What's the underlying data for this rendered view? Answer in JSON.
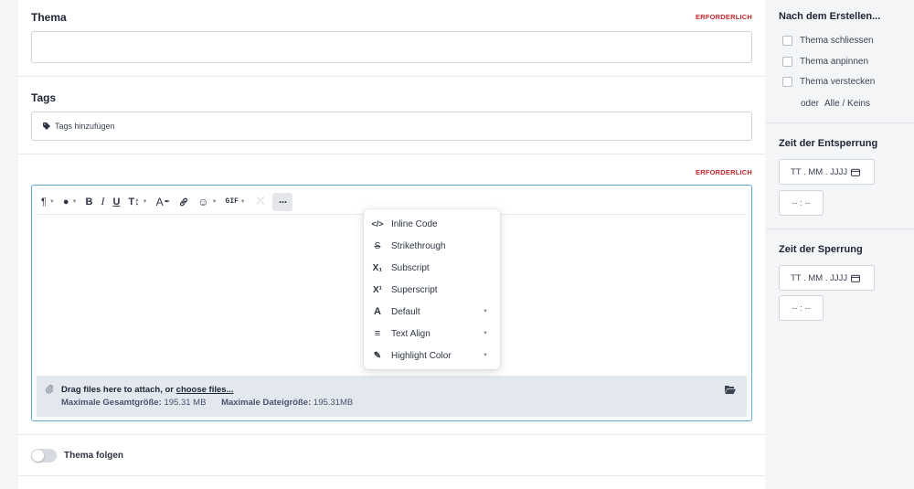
{
  "topic": {
    "label": "Thema",
    "required": "ERFORDERLICH",
    "value": ""
  },
  "tags": {
    "label": "Tags",
    "placeholder": "Tags hinzufügen"
  },
  "body": {
    "required": "ERFORDERLICH"
  },
  "toolbar": {
    "paragraph": "¶",
    "insert": "●",
    "bold": "B",
    "italic": "I",
    "underline": "U",
    "font_size": "T↕",
    "clear_format": "A",
    "link": "⊘",
    "emoji": "☺",
    "gif": "GIF",
    "strike_off": "⤬",
    "more": "···"
  },
  "more_menu": [
    {
      "icon": "</>",
      "label": "Inline Code",
      "has_caret": false
    },
    {
      "icon": "S",
      "label": "Strikethrough",
      "has_caret": false
    },
    {
      "icon": "X₁",
      "label": "Subscript",
      "has_caret": false
    },
    {
      "icon": "X¹",
      "label": "Superscript",
      "has_caret": false
    },
    {
      "icon": "A",
      "label": "Default",
      "has_caret": true
    },
    {
      "icon": "≡",
      "label": "Text Align",
      "has_caret": true
    },
    {
      "icon": "✎",
      "label": "Highlight Color",
      "has_caret": true
    }
  ],
  "upload": {
    "drag_text": "Drag files here to attach, or ",
    "choose_link": "choose files...",
    "total_label": "Maximale Gesamtgröße:",
    "total_value": "195.31 MB",
    "file_label": "Maximale Dateigröße:",
    "file_value": "195.31MB"
  },
  "follow": {
    "label": "Thema folgen",
    "on": false
  },
  "sidebar": {
    "after_title": "Nach dem Erstellen...",
    "options": [
      {
        "label": "Thema schliessen",
        "checked": false
      },
      {
        "label": "Thema anpinnen",
        "checked": false
      },
      {
        "label": "Thema verstecken",
        "checked": false
      }
    ],
    "oder": "oder",
    "all_none": "Alle / Keins",
    "unlock_title": "Zeit der Entsperrung",
    "unlock_date": "TT . MM . JJJJ",
    "unlock_time": "-- : --",
    "lock_title": "Zeit der Sperrung",
    "lock_date": "TT . MM . JJJJ",
    "lock_time": "-- : --"
  },
  "colors": {
    "accent": "#5fa8d8",
    "required": "#c0282d",
    "upload_bg": "#e3e7ee"
  }
}
